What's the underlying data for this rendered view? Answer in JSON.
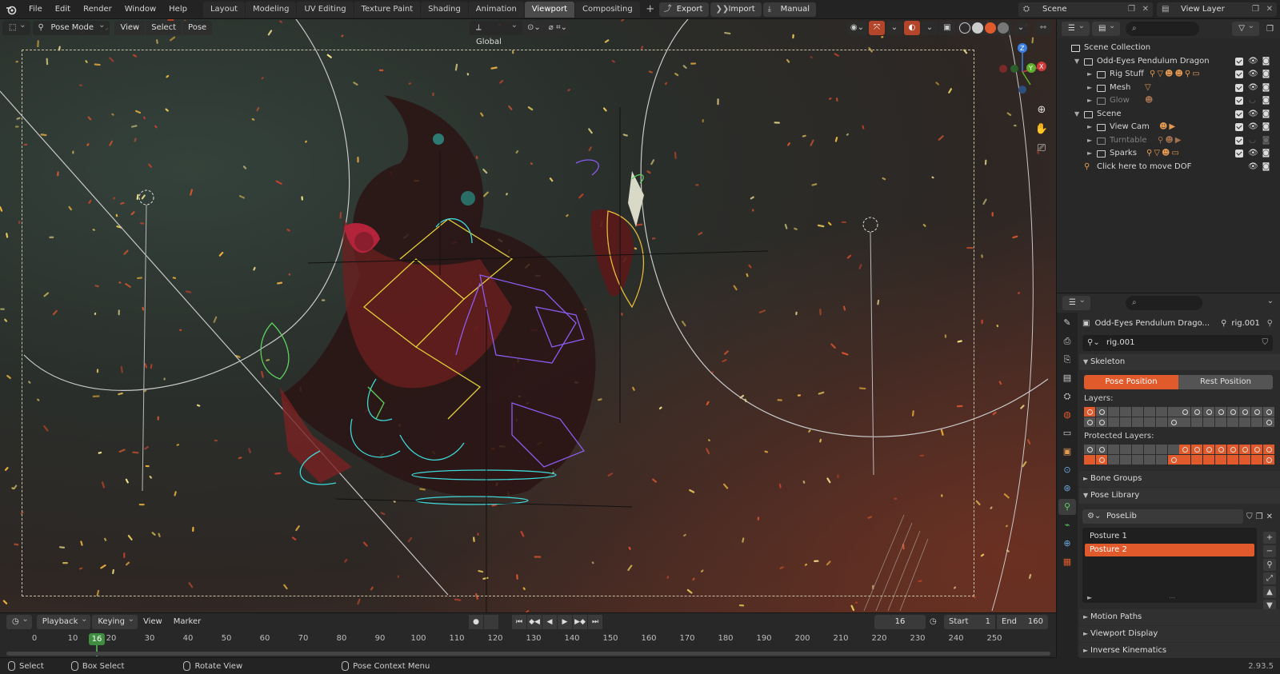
{
  "topbar": {
    "menus": [
      "File",
      "Edit",
      "Render",
      "Window",
      "Help"
    ],
    "workspaces": [
      "Layout",
      "Modeling",
      "UV Editing",
      "Texture Paint",
      "Shading",
      "Animation",
      "Viewport",
      "Compositing"
    ],
    "active_workspace": "Viewport",
    "buttons": {
      "export": "Export",
      "import": "Import",
      "manual": "Manual"
    },
    "scene": "Scene",
    "view_layer": "View Layer"
  },
  "viewport": {
    "mode": "Pose Mode",
    "menus": [
      "View",
      "Select",
      "Pose"
    ],
    "transform_orientation": "Global"
  },
  "timeline": {
    "menus": {
      "playback": "Playback",
      "keying": "Keying",
      "view": "View",
      "marker": "Marker"
    },
    "current_frame": "16",
    "start_label": "Start",
    "start": "1",
    "end_label": "End",
    "end": "160",
    "ticks": [
      "0",
      "10",
      "20",
      "30",
      "40",
      "50",
      "60",
      "70",
      "80",
      "90",
      "100",
      "110",
      "120",
      "130",
      "140",
      "150",
      "160",
      "170",
      "180",
      "190",
      "200",
      "210",
      "220",
      "230",
      "240",
      "250"
    ]
  },
  "statusbar": {
    "items": [
      "Select",
      "Box Select",
      "Rotate View",
      "Pose Context Menu"
    ],
    "version": "2.93.5"
  },
  "outliner": {
    "rows": [
      {
        "label": "Scene Collection",
        "depth": 0,
        "dim": false
      },
      {
        "label": "Odd-Eyes Pendulum Dragon",
        "depth": 1,
        "dim": false
      },
      {
        "label": "Rig Stuff",
        "depth": 2,
        "dim": false
      },
      {
        "label": "Mesh",
        "depth": 2,
        "dim": false
      },
      {
        "label": "Glow",
        "depth": 2,
        "dim": true
      },
      {
        "label": "Scene",
        "depth": 1,
        "dim": false
      },
      {
        "label": "View Cam",
        "depth": 2,
        "dim": false
      },
      {
        "label": "Turntable",
        "depth": 2,
        "dim": true
      },
      {
        "label": "Sparks",
        "depth": 2,
        "dim": false
      },
      {
        "label": "Click here to move DOF",
        "depth": 1,
        "dim": false
      }
    ]
  },
  "properties": {
    "context_object": "Odd-Eyes Pendulum Drago...",
    "context_data": "rig.001",
    "data_name": "rig.001",
    "skeleton_label": "Skeleton",
    "pose_position": "Pose Position",
    "rest_position": "Rest Position",
    "layers_label": "Layers:",
    "protected_layers_label": "Protected Layers:",
    "bone_groups": "Bone Groups",
    "pose_library": "Pose Library",
    "poselib_name": "PoseLib",
    "poses": [
      "Posture 1",
      "Posture 2"
    ],
    "selected_pose": "Posture 2",
    "motion_paths": "Motion Paths",
    "viewport_display": "Viewport Display",
    "inverse_kinematics": "Inverse Kinematics"
  },
  "colors": {
    "accent": "#e05a2b",
    "frame_green": "#3f8d3f",
    "rig_yellow": "#e6d23a",
    "rig_cyan": "#3fd8d8",
    "rig_purple": "#8b5cf0",
    "rig_green": "#5fd05f"
  }
}
